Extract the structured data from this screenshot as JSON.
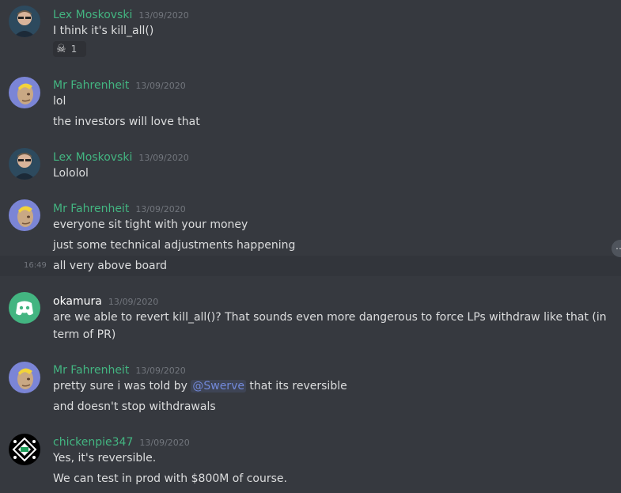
{
  "colors": {
    "background": "#36393f",
    "username_green": "#43b581",
    "username_white": "#ffffff",
    "mention": "#7289da",
    "timestamp": "#72767d"
  },
  "messages": [
    {
      "author": "Lex Moskovski",
      "timestamp": "13/09/2020",
      "avatar_icon": "lex-avatar",
      "lines": [
        "I think it's kill_all()"
      ],
      "reaction": {
        "emoji": "☠",
        "count": "1"
      }
    },
    {
      "author": "Mr Fahrenheit",
      "timestamp": "13/09/2020",
      "avatar_icon": "fahrenheit-avatar",
      "lines": [
        "lol",
        "the investors will love that"
      ]
    },
    {
      "author": "Lex Moskovski",
      "timestamp": "13/09/2020",
      "avatar_icon": "lex-avatar",
      "lines": [
        "Lololol"
      ]
    },
    {
      "author": "Mr Fahrenheit",
      "timestamp": "13/09/2020",
      "avatar_icon": "fahrenheit-avatar",
      "lines": [
        "everyone sit tight with your money",
        "just some technical adjustments happening",
        "all very above board"
      ],
      "hover_time": "16:49"
    },
    {
      "author": "okamura",
      "timestamp": "13/09/2020",
      "avatar_icon": "discord-avatar",
      "lines": [
        "are we able to revert kill_all()? That sounds even more dangerous to force LPs withdraw like that (in term of PR)"
      ]
    },
    {
      "author": "Mr Fahrenheit",
      "timestamp": "13/09/2020",
      "avatar_icon": "fahrenheit-avatar",
      "lines_mention": {
        "before": "pretty sure i was told by ",
        "mention": "@Swerve",
        "after": " that its reversible"
      },
      "lines": [
        "and doesn't stop withdrawals"
      ]
    },
    {
      "author": "chickenpie347",
      "timestamp": "13/09/2020",
      "avatar_icon": "chickenpie-avatar",
      "lines": [
        "Yes, it's reversible.",
        "We can test in prod with $800M of course."
      ]
    }
  ]
}
